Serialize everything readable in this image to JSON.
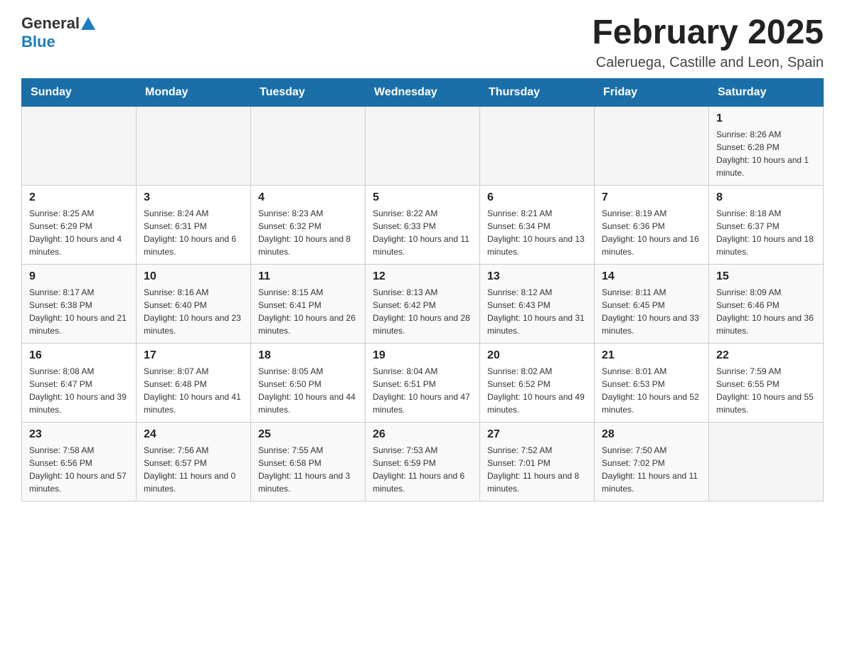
{
  "header": {
    "logo_general": "General",
    "logo_blue": "Blue",
    "title": "February 2025",
    "subtitle": "Caleruega, Castille and Leon, Spain"
  },
  "weekdays": [
    "Sunday",
    "Monday",
    "Tuesday",
    "Wednesday",
    "Thursday",
    "Friday",
    "Saturday"
  ],
  "weeks": [
    [
      {
        "day": "",
        "info": ""
      },
      {
        "day": "",
        "info": ""
      },
      {
        "day": "",
        "info": ""
      },
      {
        "day": "",
        "info": ""
      },
      {
        "day": "",
        "info": ""
      },
      {
        "day": "",
        "info": ""
      },
      {
        "day": "1",
        "info": "Sunrise: 8:26 AM\nSunset: 6:28 PM\nDaylight: 10 hours and 1 minute."
      }
    ],
    [
      {
        "day": "2",
        "info": "Sunrise: 8:25 AM\nSunset: 6:29 PM\nDaylight: 10 hours and 4 minutes."
      },
      {
        "day": "3",
        "info": "Sunrise: 8:24 AM\nSunset: 6:31 PM\nDaylight: 10 hours and 6 minutes."
      },
      {
        "day": "4",
        "info": "Sunrise: 8:23 AM\nSunset: 6:32 PM\nDaylight: 10 hours and 8 minutes."
      },
      {
        "day": "5",
        "info": "Sunrise: 8:22 AM\nSunset: 6:33 PM\nDaylight: 10 hours and 11 minutes."
      },
      {
        "day": "6",
        "info": "Sunrise: 8:21 AM\nSunset: 6:34 PM\nDaylight: 10 hours and 13 minutes."
      },
      {
        "day": "7",
        "info": "Sunrise: 8:19 AM\nSunset: 6:36 PM\nDaylight: 10 hours and 16 minutes."
      },
      {
        "day": "8",
        "info": "Sunrise: 8:18 AM\nSunset: 6:37 PM\nDaylight: 10 hours and 18 minutes."
      }
    ],
    [
      {
        "day": "9",
        "info": "Sunrise: 8:17 AM\nSunset: 6:38 PM\nDaylight: 10 hours and 21 minutes."
      },
      {
        "day": "10",
        "info": "Sunrise: 8:16 AM\nSunset: 6:40 PM\nDaylight: 10 hours and 23 minutes."
      },
      {
        "day": "11",
        "info": "Sunrise: 8:15 AM\nSunset: 6:41 PM\nDaylight: 10 hours and 26 minutes."
      },
      {
        "day": "12",
        "info": "Sunrise: 8:13 AM\nSunset: 6:42 PM\nDaylight: 10 hours and 28 minutes."
      },
      {
        "day": "13",
        "info": "Sunrise: 8:12 AM\nSunset: 6:43 PM\nDaylight: 10 hours and 31 minutes."
      },
      {
        "day": "14",
        "info": "Sunrise: 8:11 AM\nSunset: 6:45 PM\nDaylight: 10 hours and 33 minutes."
      },
      {
        "day": "15",
        "info": "Sunrise: 8:09 AM\nSunset: 6:46 PM\nDaylight: 10 hours and 36 minutes."
      }
    ],
    [
      {
        "day": "16",
        "info": "Sunrise: 8:08 AM\nSunset: 6:47 PM\nDaylight: 10 hours and 39 minutes."
      },
      {
        "day": "17",
        "info": "Sunrise: 8:07 AM\nSunset: 6:48 PM\nDaylight: 10 hours and 41 minutes."
      },
      {
        "day": "18",
        "info": "Sunrise: 8:05 AM\nSunset: 6:50 PM\nDaylight: 10 hours and 44 minutes."
      },
      {
        "day": "19",
        "info": "Sunrise: 8:04 AM\nSunset: 6:51 PM\nDaylight: 10 hours and 47 minutes."
      },
      {
        "day": "20",
        "info": "Sunrise: 8:02 AM\nSunset: 6:52 PM\nDaylight: 10 hours and 49 minutes."
      },
      {
        "day": "21",
        "info": "Sunrise: 8:01 AM\nSunset: 6:53 PM\nDaylight: 10 hours and 52 minutes."
      },
      {
        "day": "22",
        "info": "Sunrise: 7:59 AM\nSunset: 6:55 PM\nDaylight: 10 hours and 55 minutes."
      }
    ],
    [
      {
        "day": "23",
        "info": "Sunrise: 7:58 AM\nSunset: 6:56 PM\nDaylight: 10 hours and 57 minutes."
      },
      {
        "day": "24",
        "info": "Sunrise: 7:56 AM\nSunset: 6:57 PM\nDaylight: 11 hours and 0 minutes."
      },
      {
        "day": "25",
        "info": "Sunrise: 7:55 AM\nSunset: 6:58 PM\nDaylight: 11 hours and 3 minutes."
      },
      {
        "day": "26",
        "info": "Sunrise: 7:53 AM\nSunset: 6:59 PM\nDaylight: 11 hours and 6 minutes."
      },
      {
        "day": "27",
        "info": "Sunrise: 7:52 AM\nSunset: 7:01 PM\nDaylight: 11 hours and 8 minutes."
      },
      {
        "day": "28",
        "info": "Sunrise: 7:50 AM\nSunset: 7:02 PM\nDaylight: 11 hours and 11 minutes."
      },
      {
        "day": "",
        "info": ""
      }
    ]
  ]
}
